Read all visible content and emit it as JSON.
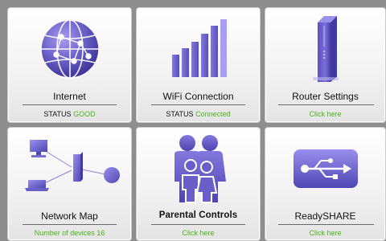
{
  "tiles": {
    "internet": {
      "title": "Internet",
      "status_label": "STATUS",
      "status_value": "GOOD",
      "icon": "globe-icon"
    },
    "wifi": {
      "title": "WiFi Connection",
      "status_label": "STATUS",
      "status_value": "Connected",
      "icon": "signal-bars-icon"
    },
    "router": {
      "title": "Router Settings",
      "link": "Click here",
      "icon": "router-icon"
    },
    "network_map": {
      "title": "Network Map",
      "devices_text": "Number of devices 16",
      "icon": "network-map-icon"
    },
    "parental": {
      "title": "Parental Controls",
      "link": "Click here",
      "icon": "family-icon"
    },
    "readyshare": {
      "title": "ReadySHARE",
      "link": "Click here",
      "icon": "usb-icon"
    }
  },
  "colors": {
    "accent_purple": "#6a5fc8",
    "status_green": "#4db31a",
    "background": "#8e8e8e"
  }
}
